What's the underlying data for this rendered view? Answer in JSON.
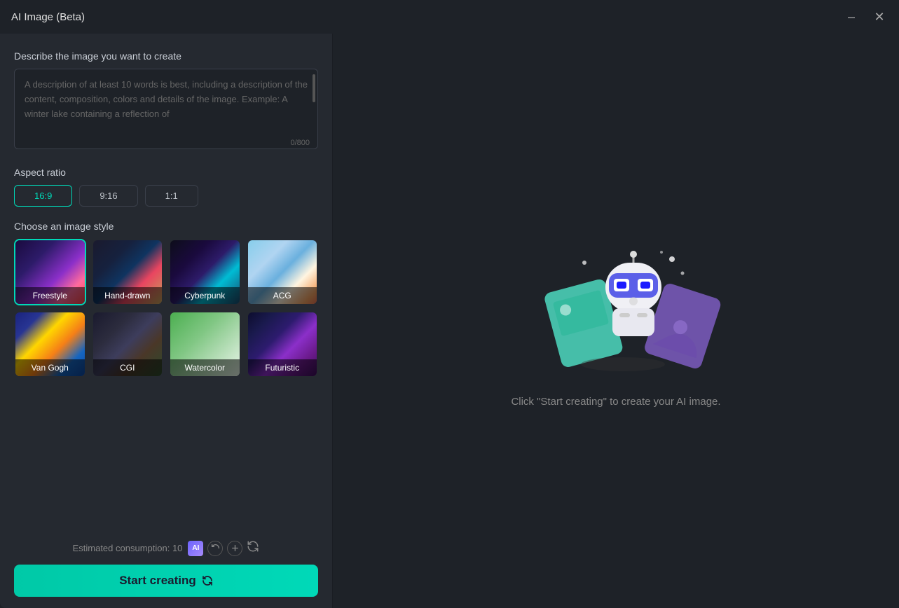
{
  "window": {
    "title": "AI Image (Beta)",
    "minimize_label": "minimize",
    "close_label": "close"
  },
  "left_panel": {
    "description_label": "Describe the image you want to create",
    "description_placeholder": "A description of at least 10 words is best, including a description of the content, composition, colors and details of the image. Example: A winter lake containing a reflection of",
    "char_count": "0/800",
    "aspect_ratio_label": "Aspect ratio",
    "aspect_buttons": [
      {
        "id": "16-9",
        "label": "16:9",
        "active": true
      },
      {
        "id": "9-16",
        "label": "9:16",
        "active": false
      },
      {
        "id": "1-1",
        "label": "1:1",
        "active": false
      }
    ],
    "style_label": "Choose an image style",
    "styles": [
      {
        "id": "freestyle",
        "label": "Freestyle",
        "selected": true,
        "bg_class": "style-freestyle"
      },
      {
        "id": "hand-drawn",
        "label": "Hand-drawn",
        "selected": false,
        "bg_class": "style-hand-drawn"
      },
      {
        "id": "cyberpunk",
        "label": "Cyberpunk",
        "selected": false,
        "bg_class": "style-cyberpunk"
      },
      {
        "id": "acg",
        "label": "ACG",
        "selected": false,
        "bg_class": "style-acg"
      },
      {
        "id": "van-gogh",
        "label": "Van Gogh",
        "selected": false,
        "bg_class": "style-vangogh"
      },
      {
        "id": "cgi",
        "label": "CGI",
        "selected": false,
        "bg_class": "style-cgi"
      },
      {
        "id": "watercolor",
        "label": "Watercolor",
        "selected": false,
        "bg_class": "style-watercolor"
      },
      {
        "id": "futuristic",
        "label": "Futuristic",
        "selected": false,
        "bg_class": "style-futuristic"
      }
    ],
    "consumption_label": "Estimated consumption: 10",
    "ai_badge": "AI",
    "start_btn_label": "Start creating"
  },
  "right_panel": {
    "placeholder_text": "Click \"Start creating\" to create your AI image."
  }
}
